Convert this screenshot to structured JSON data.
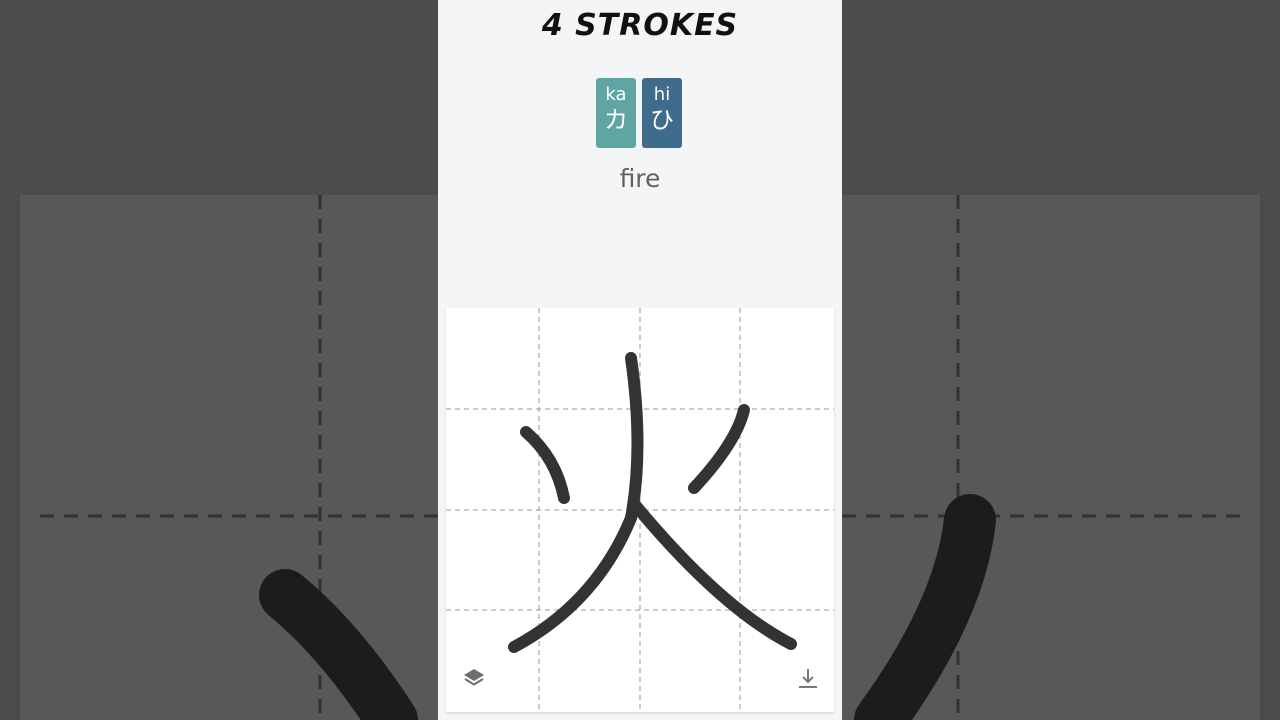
{
  "header": {
    "stroke_count_label": "4 STROKES"
  },
  "readings": [
    {
      "romaji": "ka",
      "kana": "カ",
      "color": "#5fa5a3"
    },
    {
      "romaji": "hi",
      "kana": "ひ",
      "color": "#3f6b8c"
    }
  ],
  "kanji": {
    "meaning": "fire"
  },
  "toolbar": {
    "layers_icon": "layers-icon",
    "download_icon": "download-icon"
  },
  "colors": {
    "stroke": "#333333",
    "panel": "#f4f5f7",
    "grid_line": "#9a9a9a"
  }
}
